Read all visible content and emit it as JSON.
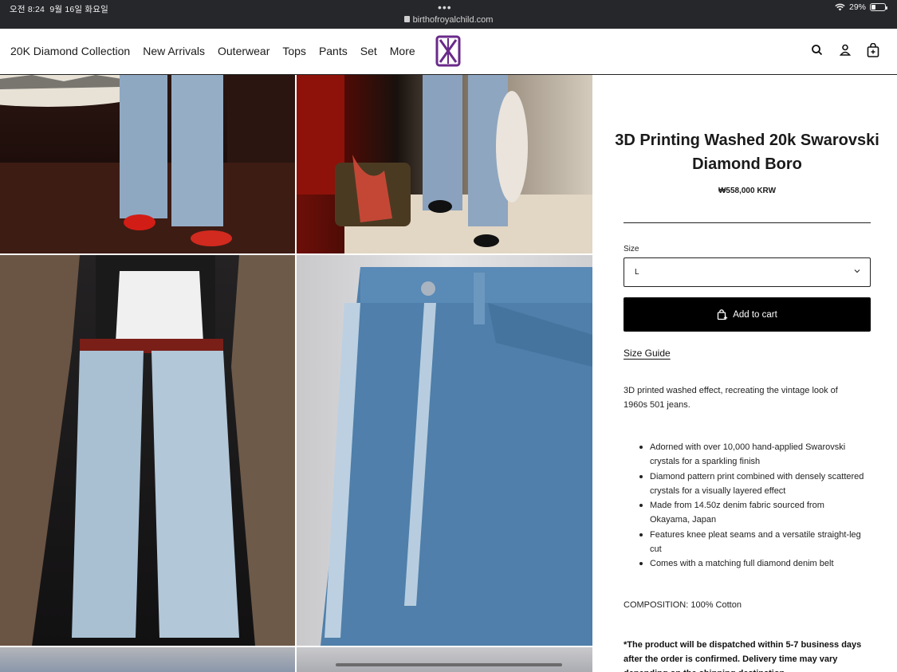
{
  "status_bar": {
    "time": "오전 8:24",
    "date": "9월 16일 화요일",
    "dots": "•••",
    "url": "birthofroyalchild.com",
    "battery": "29%",
    "battery_level": 0.29
  },
  "nav": {
    "items": [
      {
        "label": "20K Diamond Collection"
      },
      {
        "label": "New Arrivals"
      },
      {
        "label": "Outerwear"
      },
      {
        "label": "Tops"
      },
      {
        "label": "Pants"
      },
      {
        "label": "Set"
      },
      {
        "label": "More"
      }
    ],
    "icons": [
      "search-icon",
      "account-icon",
      "cart-icon"
    ],
    "logo_color": "#6a2a8a"
  },
  "gallery": {
    "images": [
      "jeans-red-shoes-photo",
      "jeans-handbag-photo",
      "fur-coat-outfit-photo",
      "jeans-closeup-photo",
      "jeans-partial-photo-5",
      "jeans-partial-photo-6"
    ]
  },
  "product": {
    "title": "3D Printing Washed 20k Swarovski Diamond Boro",
    "price": "₩558,000 KRW",
    "size_label": "Size",
    "size_value": "L",
    "add_to_cart": "Add to cart",
    "size_guide": "Size Guide",
    "description": "3D printed washed effect, recreating the vintage look of 1960s 501 jeans.",
    "features": [
      "Adorned with over 10,000 hand-applied Swarovski crystals for a sparkling finish",
      "Diamond pattern print combined with densely scattered crystals for a visually layered effect",
      "Made from 14.50z denim fabric sourced from Okayama, Japan",
      "Features knee pleat seams and a versatile straight-leg cut",
      "Comes with a matching full diamond denim belt"
    ],
    "composition": "COMPOSITION: 100% Cotton",
    "dispatch_note": "*The product will be dispatched within 5-7 business days after the order is confirmed. Delivery time may vary depending on the shipping destination."
  }
}
